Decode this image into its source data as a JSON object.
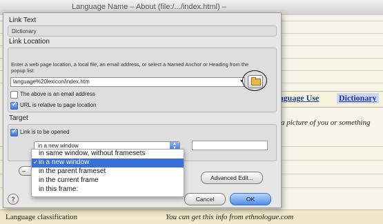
{
  "window": {
    "title": "Language Name – About (file:/.../index.html) –"
  },
  "background": {
    "tabs": [
      "nguage Use",
      "Dictionary"
    ],
    "picture_text": "a picture of you or something",
    "row_cells": [
      "Language classification",
      "You can get this info from ethnologue.com"
    ]
  },
  "dialog": {
    "link_text_label": "Link Text",
    "link_text_value": "Dictionary",
    "link_location_label": "Link Location",
    "instructions": "Enter a web page location, a local file, an email address, or select a Named Anchor or Heading from the popup list:",
    "url_value": "language%20lexicon/index.htm",
    "browse_icon": "folder-icon",
    "email_checkbox": {
      "label": "The above is an email address",
      "checked": false
    },
    "relative_checkbox": {
      "label": "URL is relative to page location",
      "checked": true
    },
    "target_label": "Target",
    "opened_checkbox": {
      "label": "Link is to be opened",
      "checked": true
    },
    "target_select_value": "in a new window",
    "target_options": [
      "in same window, without framesets",
      "in a new window",
      "in the parent frameset",
      "in the current frame",
      "in this frame:"
    ],
    "selected_option_index": 1,
    "small_button_label": "–",
    "advanced_button": "Advanced Edit...",
    "cancel_button": "Cancel",
    "ok_button": "OK",
    "help_button": "?"
  }
}
